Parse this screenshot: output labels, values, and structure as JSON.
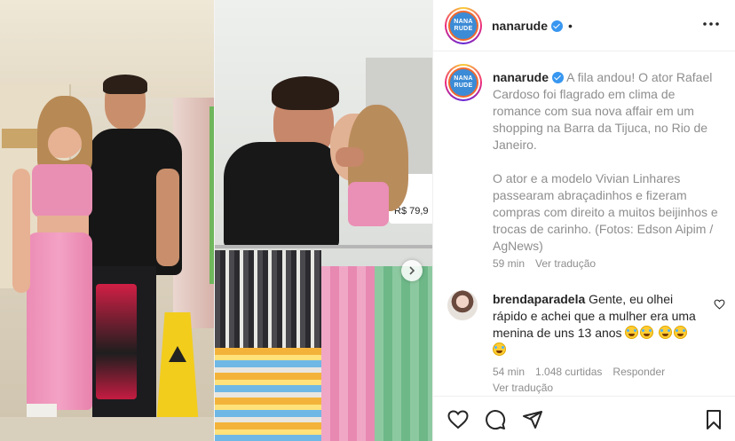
{
  "post": {
    "username": "nanarude",
    "avatar_text": [
      "NANA",
      "RUDE"
    ],
    "header_separator": "•",
    "more_icon": "more-horizontal-icon",
    "next_icon": "chevron-right-icon"
  },
  "caption": {
    "username": "nanarude",
    "paragraph1": "A fila andou! O ator Rafael Cardoso foi flagrado em clima de romance com sua nova affair em um shopping na Barra da Tijuca, no Rio de Janeiro.",
    "paragraph2": "O ator e a modelo Vivian Linhares passearam abraçadinhos e fizeram compras com direito a muitos beijinhos e trocas de carinho. (Fotos: Edson Aipim / AgNews)",
    "time": "59 min",
    "translate": "Ver tradução"
  },
  "comment": {
    "username": "brendaparadela",
    "text": "Gente, eu olhei rápido e achei que a mulher era uma menina de uns 13 anos",
    "emoji": "😂",
    "time": "54 min",
    "likes": "1.048 curtidas",
    "reply": "Responder",
    "translate": "Ver tradução"
  },
  "photo": {
    "price_tag": "R$ 79,9"
  },
  "actions": [
    "heart-icon",
    "comment-icon",
    "share-icon",
    "bookmark-icon"
  ],
  "colors": {
    "verified": "#3897f0",
    "muted_text": "#8e8e8e",
    "text": "#262626",
    "divider": "#efefef"
  }
}
